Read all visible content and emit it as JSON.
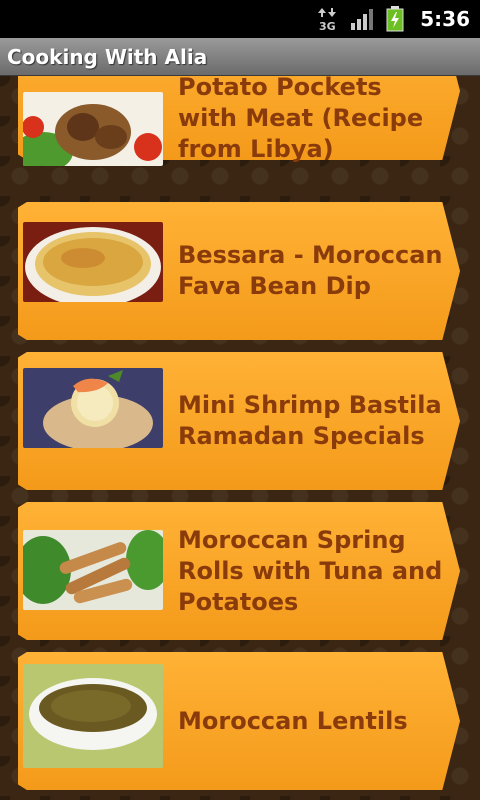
{
  "status_bar": {
    "network_label": "3G",
    "time": "5:36",
    "icons": [
      "data-arrows-icon",
      "signal-bars-icon",
      "battery-charging-icon"
    ]
  },
  "app_bar": {
    "title": "Cooking With Alia"
  },
  "recipes": [
    {
      "title": "Potato Pockets with Meat (Recipe from Libya)",
      "thumb": "grilled-meat-plate-image"
    },
    {
      "title": "Bessara - Moroccan Fava Bean Dip",
      "thumb": "fava-bean-dip-bowl-image"
    },
    {
      "title": "Mini Shrimp Bastila  Ramadan Specials",
      "thumb": "shrimp-bastila-image"
    },
    {
      "title": "Moroccan Spring Rolls with Tuna and Potatoes",
      "thumb": "spring-rolls-image"
    },
    {
      "title": "Moroccan Lentils",
      "thumb": "lentils-bowl-image"
    }
  ],
  "colors": {
    "card": "#f7a126",
    "card_text": "#8a3b0b",
    "background": "#3a2612",
    "title_bar": "#808080"
  }
}
